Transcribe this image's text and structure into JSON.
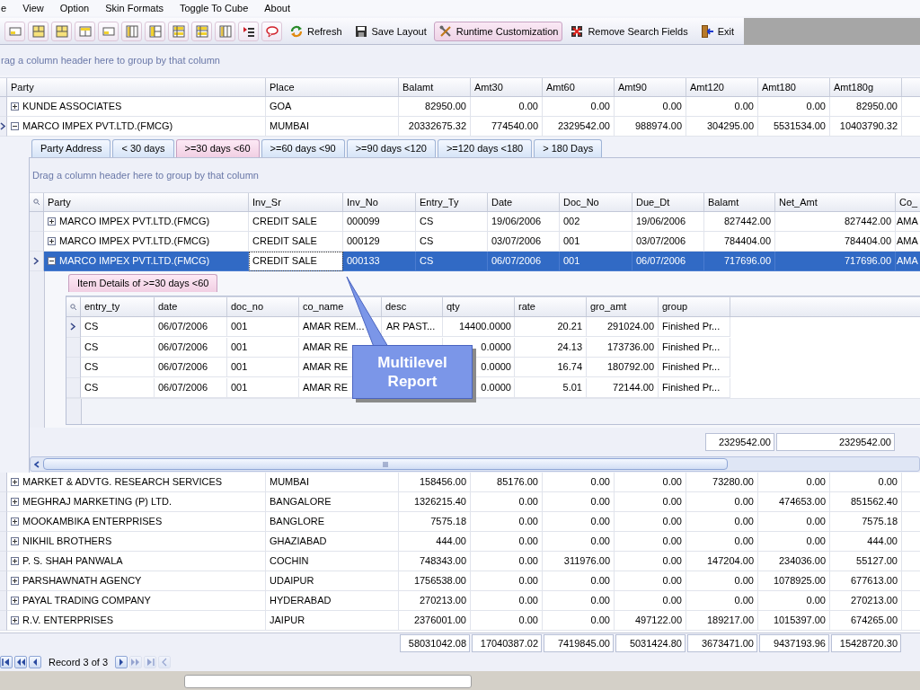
{
  "menu": [
    {
      "label": "e"
    },
    {
      "label": "View"
    },
    {
      "label": "Option"
    },
    {
      "label": "Skin Formats"
    },
    {
      "label": "Toggle To Cube"
    },
    {
      "label": "About"
    }
  ],
  "toolbar": {
    "icon_buttons": [
      {
        "kind": "pane-small"
      },
      {
        "kind": "pane-split"
      },
      {
        "kind": "pane-split"
      },
      {
        "kind": "pane-top"
      },
      {
        "kind": "pane-small"
      },
      {
        "kind": "columns"
      },
      {
        "kind": "columns-left"
      },
      {
        "kind": "rows"
      },
      {
        "kind": "rows"
      },
      {
        "kind": "columns"
      },
      {
        "kind": "indent"
      },
      {
        "kind": "balloon"
      }
    ],
    "buttons": [
      {
        "kind": "refresh",
        "label": "Refresh",
        "pressed": false
      },
      {
        "kind": "save",
        "label": "Save Layout",
        "pressed": false
      },
      {
        "kind": "tools",
        "label": "Runtime Customization",
        "pressed": true
      },
      {
        "kind": "remove",
        "label": "Remove Search Fields",
        "pressed": false
      },
      {
        "kind": "exit",
        "label": "Exit",
        "pressed": false
      }
    ]
  },
  "group_panel": {
    "hint": "rag a column header here to group by that column"
  },
  "main_grid": {
    "columns": [
      {
        "label": "Party",
        "kind": "text"
      },
      {
        "label": "Place",
        "kind": "text"
      },
      {
        "label": "Balamt",
        "kind": "number"
      },
      {
        "label": "Amt30",
        "kind": "number"
      },
      {
        "label": "Amt60",
        "kind": "number"
      },
      {
        "label": "Amt90",
        "kind": "number"
      },
      {
        "label": "Amt120",
        "kind": "number"
      },
      {
        "label": "Amt180",
        "kind": "number"
      },
      {
        "label": "Amt180g",
        "kind": "number"
      }
    ],
    "rows": [
      {
        "cells": [
          "KUNDE ASSOCIATES",
          "GOA",
          "82950.00",
          "0.00",
          "0.00",
          "0.00",
          "0.00",
          "0.00",
          "82950.00"
        ],
        "expanded": false,
        "current": false
      },
      {
        "cells": [
          "MARCO IMPEX PVT.LTD.(FMCG)",
          "MUMBAI",
          "20332675.32",
          "774540.00",
          "2329542.00",
          "988974.00",
          "304295.00",
          "5531534.00",
          "10403790.32"
        ],
        "expanded": true,
        "current": true,
        "detail": {
          "tabs": [
            {
              "label": "Party Address",
              "selected": false
            },
            {
              "label": "< 30 days",
              "selected": false
            },
            {
              "label": ">=30 days <60",
              "selected": true
            },
            {
              "label": ">=60 days <90",
              "selected": false
            },
            {
              "label": ">=90 days <120",
              "selected": false
            },
            {
              "label": ">=120 days <180",
              "selected": false
            },
            {
              "label": "> 180 Days",
              "selected": false
            }
          ],
          "hint": "Drag a column header here to group by that column",
          "columns": [
            {
              "label": "Party",
              "kind": "text"
            },
            {
              "label": "Inv_Sr",
              "kind": "text"
            },
            {
              "label": "Inv_No",
              "kind": "text"
            },
            {
              "label": "Entry_Ty",
              "kind": "text"
            },
            {
              "label": "Date",
              "kind": "text"
            },
            {
              "label": "Doc_No",
              "kind": "text"
            },
            {
              "label": "Due_Dt",
              "kind": "text"
            },
            {
              "label": "Balamt",
              "kind": "number"
            },
            {
              "label": "Net_Amt",
              "kind": "number"
            },
            {
              "label": "Co_",
              "kind": "text"
            }
          ],
          "rows": [
            {
              "cells": [
                "MARCO IMPEX PVT.LTD.(FMCG)",
                "CREDIT SALE",
                "000099",
                "CS",
                "19/06/2006",
                "002",
                "19/06/2006",
                "827442.00",
                "827442.00",
                "AMA"
              ],
              "expanded": false,
              "selected": false,
              "current": false
            },
            {
              "cells": [
                "MARCO IMPEX PVT.LTD.(FMCG)",
                "CREDIT SALE",
                "000129",
                "CS",
                "03/07/2006",
                "001",
                "03/07/2006",
                "784404.00",
                "784404.00",
                "AMA"
              ],
              "expanded": false,
              "selected": false,
              "current": false
            },
            {
              "cells": [
                "MARCO IMPEX PVT.LTD.(FMCG)",
                {
                  "text": "CREDIT SALE",
                  "focused": true
                },
                "000133",
                "CS",
                "06/07/2006",
                "001",
                "06/07/2006",
                "717696.00",
                "717696.00",
                "AMA"
              ],
              "expanded": true,
              "selected": true,
              "current": true,
              "detail": {
                "tabs": [
                  {
                    "label": "Item Details of  >=30 days <60",
                    "selected": true
                  }
                ],
                "columns": [
                  {
                    "label": "entry_ty",
                    "kind": "text"
                  },
                  {
                    "label": "date",
                    "kind": "text"
                  },
                  {
                    "label": "doc_no",
                    "kind": "text"
                  },
                  {
                    "label": "co_name",
                    "kind": "text"
                  },
                  {
                    "label": "desc",
                    "kind": "text"
                  },
                  {
                    "label": "qty",
                    "kind": "number"
                  },
                  {
                    "label": "rate",
                    "kind": "number"
                  },
                  {
                    "label": "gro_amt",
                    "kind": "number"
                  },
                  {
                    "label": "group",
                    "kind": "text"
                  }
                ],
                "rows": [
                  {
                    "left_cells": [
                      "CS",
                      "06/07/2006",
                      "001",
                      "AMAR REM..."
                    ],
                    "description": "AR PAST...",
                    "right_cells": [
                      "14400.0000",
                      "20.21",
                      "291024.00",
                      "Finished Pr..."
                    ],
                    "current": true
                  },
                  {
                    "left_cells": [
                      "CS",
                      "06/07/2006",
                      "001",
                      "AMAR RE"
                    ],
                    "right_cells": [
                      "0.0000",
                      "24.13",
                      "173736.00",
                      "Finished Pr..."
                    ],
                    "current": false
                  },
                  {
                    "left_cells": [
                      "CS",
                      "06/07/2006",
                      "001",
                      "AMAR RE"
                    ],
                    "right_cells": [
                      "0.0000",
                      "16.74",
                      "180792.00",
                      "Finished Pr..."
                    ],
                    "current": false
                  },
                  {
                    "left_cells": [
                      "CS",
                      "06/07/2006",
                      "001",
                      "AMAR RE"
                    ],
                    "right_cells": [
                      "0.0000",
                      "5.01",
                      "72144.00",
                      "Finished Pr..."
                    ],
                    "current": false
                  }
                ]
              }
            }
          ],
          "totals": [
            "2329542.00",
            "2329542.00"
          ]
        }
      },
      {
        "cells": [
          "MARKET & ADVTG. RESEARCH SERVICES",
          "MUMBAI",
          "158456.00",
          "85176.00",
          "0.00",
          "0.00",
          "73280.00",
          "0.00",
          "0.00"
        ],
        "expanded": false,
        "current": false
      },
      {
        "cells": [
          "MEGHRAJ MARKETING (P) LTD.",
          "BANGALORE",
          "1326215.40",
          "0.00",
          "0.00",
          "0.00",
          "0.00",
          "474653.00",
          "851562.40"
        ],
        "expanded": false,
        "current": false
      },
      {
        "cells": [
          "MOOKAMBIKA ENTERPRISES",
          "BANGLORE",
          "7575.18",
          "0.00",
          "0.00",
          "0.00",
          "0.00",
          "0.00",
          "7575.18"
        ],
        "expanded": false,
        "current": false
      },
      {
        "cells": [
          "NIKHIL BROTHERS",
          "GHAZIABAD",
          "444.00",
          "0.00",
          "0.00",
          "0.00",
          "0.00",
          "0.00",
          "444.00"
        ],
        "expanded": false,
        "current": false
      },
      {
        "cells": [
          "P. S. SHAH PANWALA",
          "COCHIN",
          "748343.00",
          "0.00",
          "311976.00",
          "0.00",
          "147204.00",
          "234036.00",
          "55127.00"
        ],
        "expanded": false,
        "current": false
      },
      {
        "cells": [
          "PARSHAWNATH AGENCY",
          "UDAIPUR",
          "1756538.00",
          "0.00",
          "0.00",
          "0.00",
          "0.00",
          "1078925.00",
          "677613.00"
        ],
        "expanded": false,
        "current": false
      },
      {
        "cells": [
          "PAYAL TRADING COMPANY",
          "HYDERABAD",
          "270213.00",
          "0.00",
          "0.00",
          "0.00",
          "0.00",
          "0.00",
          "270213.00"
        ],
        "expanded": false,
        "current": false
      },
      {
        "cells": [
          "R.V. ENTERPRISES",
          "JAIPUR",
          "2376001.00",
          "0.00",
          "0.00",
          "497122.00",
          "189217.00",
          "1015397.00",
          "674265.00"
        ],
        "expanded": false,
        "current": false
      }
    ],
    "totals": [
      "58031042.08",
      "17040387.02",
      "7419845.00",
      "5031424.80",
      "3673471.00",
      "9437193.96",
      "15428720.30"
    ]
  },
  "navigator": {
    "buttons_before": [
      {
        "kind": "first",
        "disabled": false
      },
      {
        "kind": "prev-page",
        "disabled": false
      },
      {
        "kind": "prev",
        "disabled": false
      }
    ],
    "record": "Record 3 of 3",
    "buttons_after": [
      {
        "kind": "next",
        "disabled": false
      },
      {
        "kind": "next-page",
        "disabled": true
      },
      {
        "kind": "last",
        "disabled": true
      },
      {
        "kind": "edge",
        "disabled": true
      }
    ]
  },
  "callout": {
    "text": "Multilevel Report"
  }
}
